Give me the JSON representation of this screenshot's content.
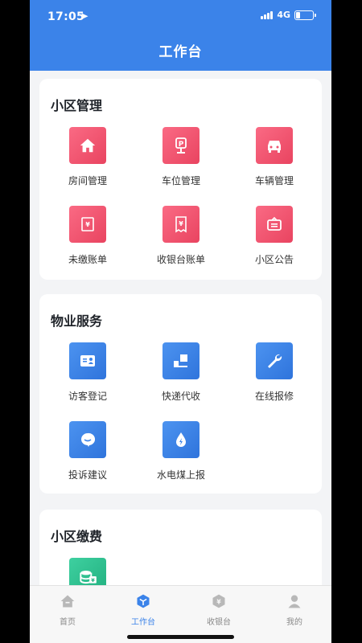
{
  "status_bar": {
    "time": "17:05",
    "network": "4G"
  },
  "header": {
    "title": "工作台"
  },
  "sections": [
    {
      "title": "小区管理",
      "items": [
        {
          "label": "房间管理",
          "icon": "house-icon",
          "color": "red"
        },
        {
          "label": "车位管理",
          "icon": "parking-icon",
          "color": "red"
        },
        {
          "label": "车辆管理",
          "icon": "car-icon",
          "color": "red"
        },
        {
          "label": "未缴账单",
          "icon": "unpaid-bill-icon",
          "color": "red"
        },
        {
          "label": "收银台账单",
          "icon": "receipt-icon",
          "color": "red"
        },
        {
          "label": "小区公告",
          "icon": "notice-icon",
          "color": "red"
        }
      ]
    },
    {
      "title": "物业服务",
      "items": [
        {
          "label": "访客登记",
          "icon": "visitor-card-icon",
          "color": "blue"
        },
        {
          "label": "快递代收",
          "icon": "package-icon",
          "color": "blue"
        },
        {
          "label": "在线报修",
          "icon": "wrench-icon",
          "color": "blue"
        },
        {
          "label": "投诉建议",
          "icon": "chat-icon",
          "color": "blue"
        },
        {
          "label": "水电煤上报",
          "icon": "utility-drop-icon",
          "color": "blue"
        }
      ]
    },
    {
      "title": "小区缴费",
      "items": [
        {
          "label": "",
          "icon": "coins-icon",
          "color": "green"
        }
      ]
    }
  ],
  "tabbar": [
    {
      "label": "首页",
      "icon": "home-tab-icon",
      "active": false
    },
    {
      "label": "工作台",
      "icon": "workbench-tab-icon",
      "active": true
    },
    {
      "label": "收银台",
      "icon": "cashier-tab-icon",
      "active": false
    },
    {
      "label": "我的",
      "icon": "profile-tab-icon",
      "active": false
    }
  ],
  "colors": {
    "primary": "#3b83e9",
    "accent_red": "#ef5470",
    "accent_green": "#2ec190"
  }
}
